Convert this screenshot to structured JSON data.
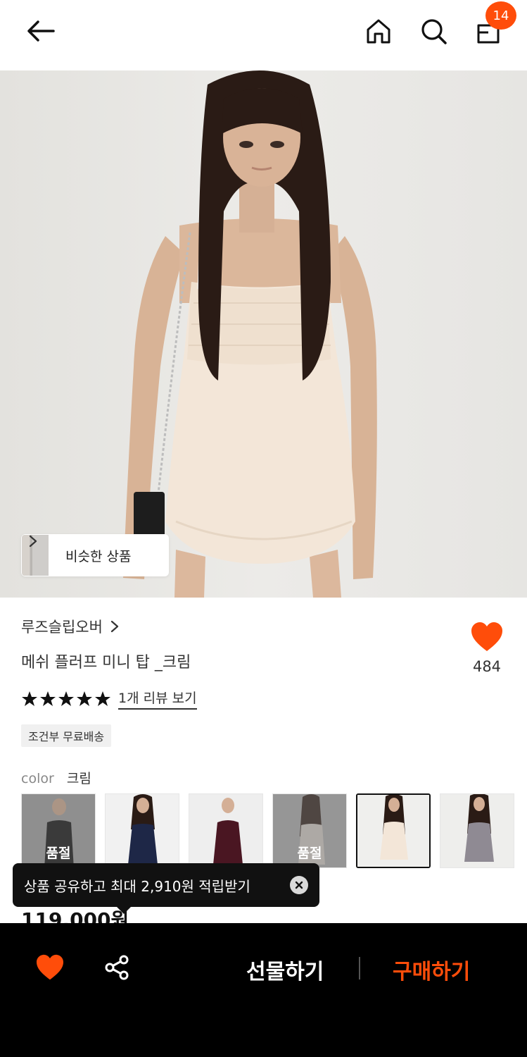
{
  "header": {
    "cart_count": "14",
    "icons": [
      "back-arrow-icon",
      "home-icon",
      "search-icon",
      "shopping-bag-icon"
    ]
  },
  "hero": {
    "similar_label": "비슷한 상품"
  },
  "product": {
    "brand": "루즈슬립오버",
    "name": "메쉬 플러프 미니 탑 _크림",
    "likes": "484",
    "rating_stars": 5,
    "review_link": "1개 리뷰 보기",
    "shipping_tag": "조건부 무료배송",
    "color_label": "color",
    "color_value": "크림",
    "price": "119,000원"
  },
  "swatches": [
    {
      "soldout": "품절"
    },
    {
      "soldout": ""
    },
    {
      "soldout": ""
    },
    {
      "soldout": "품절"
    },
    {
      "soldout": ""
    },
    {
      "soldout": ""
    }
  ],
  "tooltip": {
    "text": "상품 공유하고 최대 2,910원 적립받기"
  },
  "bottom_bar": {
    "gift_label": "선물하기",
    "buy_label": "구매하기"
  },
  "colors": {
    "accent": "#ff4d0a",
    "bar": "#000000"
  }
}
